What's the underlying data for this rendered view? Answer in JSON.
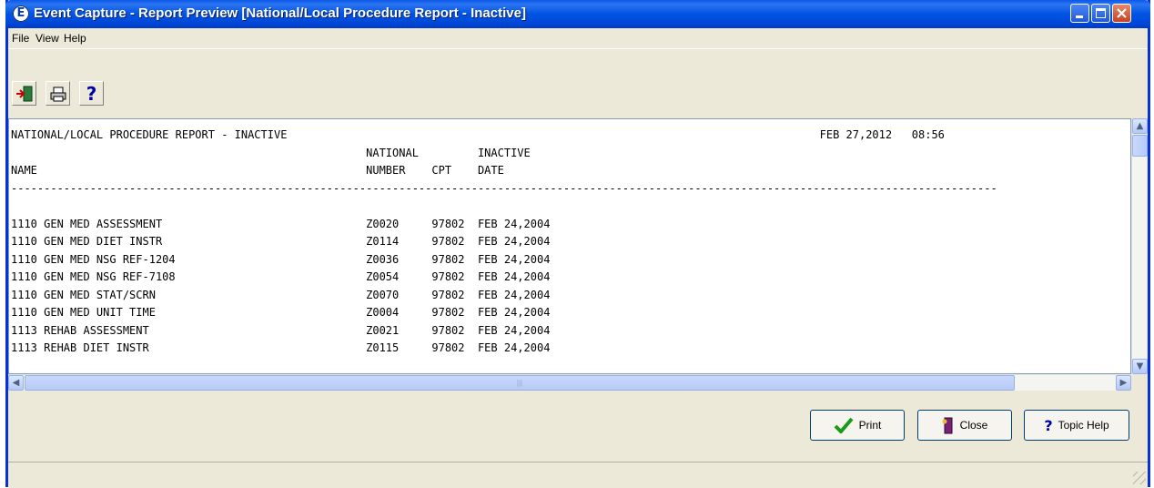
{
  "window": {
    "title": "Event Capture - Report Preview [National/Local Procedure Report - Inactive]",
    "icon": "event-capture-e-icon"
  },
  "menu": {
    "file": "File",
    "view": "View",
    "help": "Help"
  },
  "toolbar": {
    "exit_icon": "exit-door-icon",
    "print_icon": "printer-icon",
    "help_icon": "question-mark-icon"
  },
  "report": {
    "text": "NATIONAL/LOCAL PROCEDURE REPORT - INACTIVE                                                                                 FEB 27,2012   08:56\n                                                      NATIONAL         INACTIVE\nNAME                                                  NUMBER    CPT    DATE\n------------------------------------------------------------------------------------------------------------------------------------------------------\n\n1110 GEN MED ASSESSMENT                               Z0020     97802  FEB 24,2004\n1110 GEN MED DIET INSTR                               Z0114     97802  FEB 24,2004\n1110 GEN MED NSG REF-1204                             Z0036     97802  FEB 24,2004\n1110 GEN MED NSG REF-7108                             Z0054     97802  FEB 24,2004\n1110 GEN MED STAT/SCRN                                Z0070     97802  FEB 24,2004\n1110 GEN MED UNIT TIME                                Z0004     97802  FEB 24,2004\n1113 REHAB ASSESSMENT                                 Z0021     97802  FEB 24,2004\n1113 REHAB DIET INSTR                                 Z0115     97802  FEB 24,2004"
  },
  "buttons": {
    "print": "Print",
    "close": "Close",
    "topic_help": "Topic Help"
  },
  "colors": {
    "titlebar": "#0054e3",
    "face": "#ece9d8",
    "check_green": "#1a9a1a"
  }
}
